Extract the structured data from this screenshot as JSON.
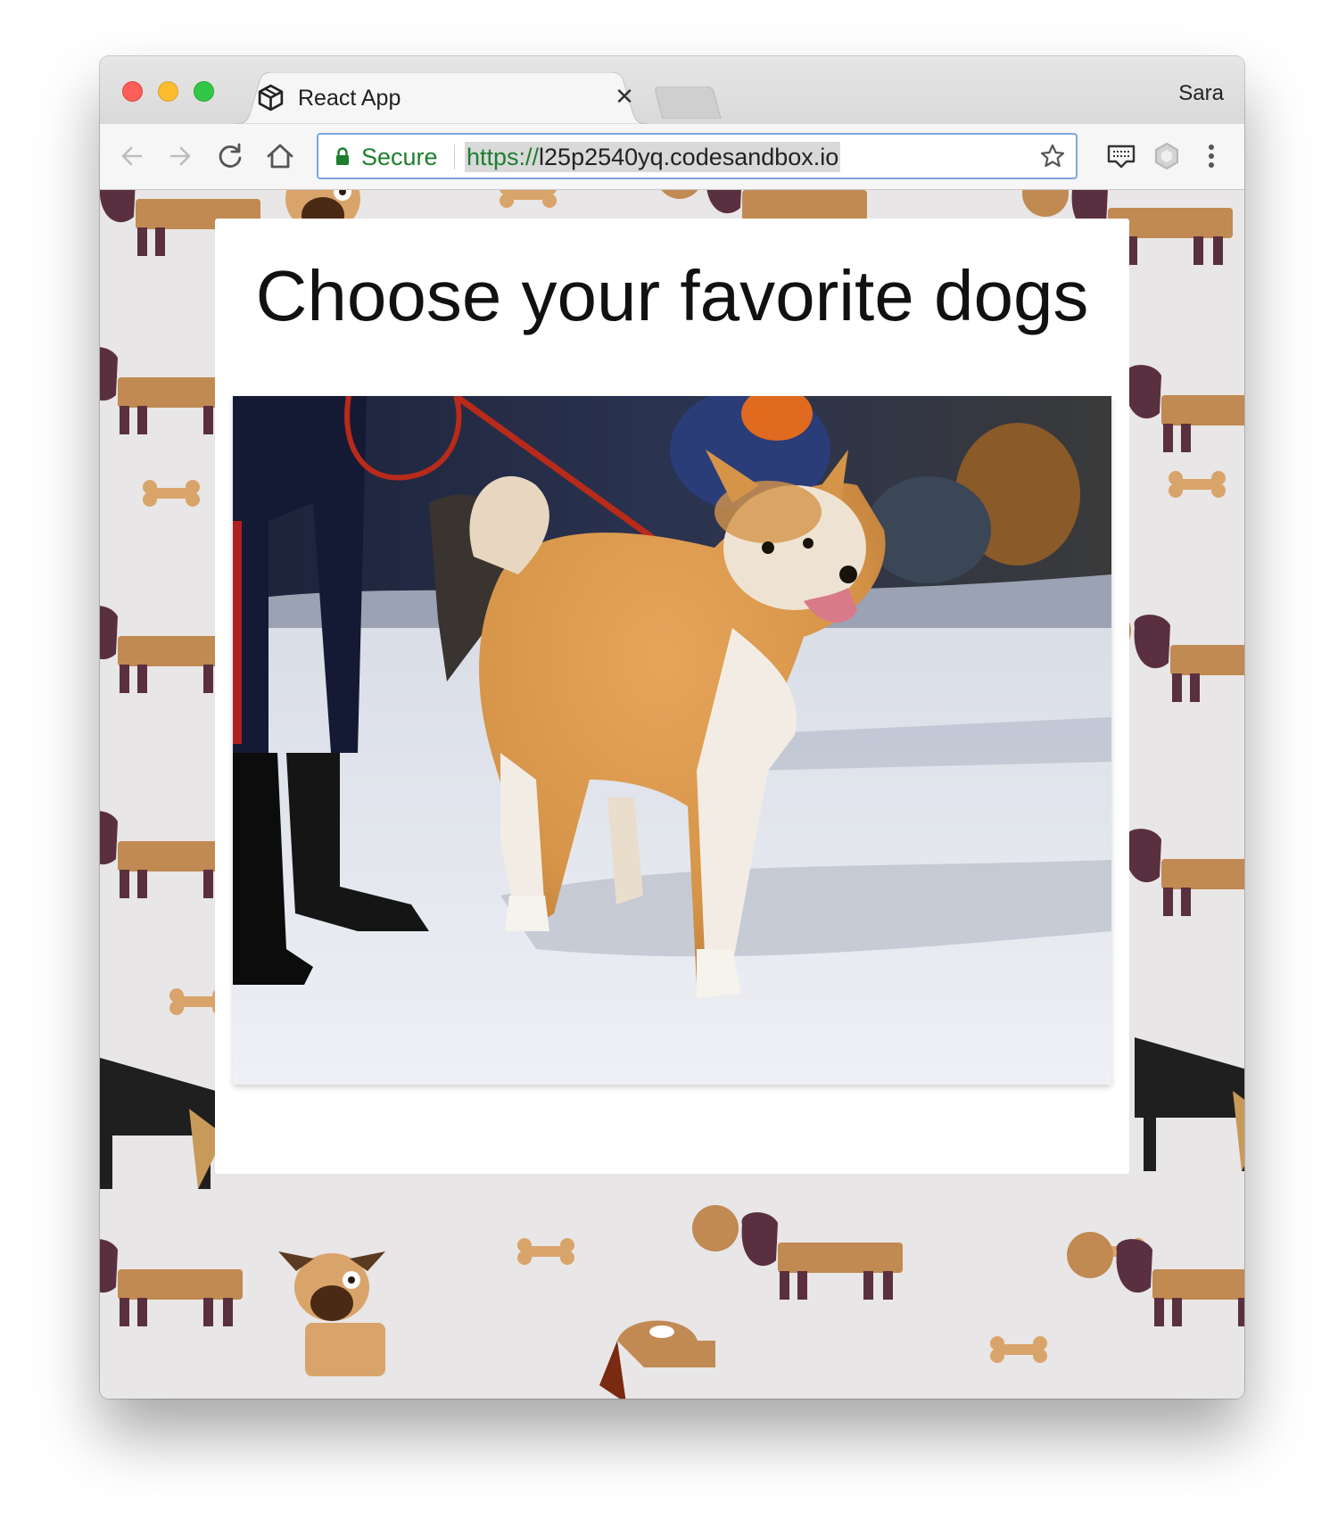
{
  "browser": {
    "tab": {
      "title": "React App",
      "icon": "codesandbox-cube-icon",
      "close_glyph": "✕"
    },
    "profile_name": "Sara",
    "toolbar": {
      "back_icon": "arrow-left-icon",
      "forward_icon": "arrow-right-icon",
      "reload_icon": "reload-icon",
      "home_icon": "home-icon"
    },
    "omnibox": {
      "security_label": "Secure",
      "url_scheme": "https://",
      "url_host": "l25p2540yq.codesandbox.io"
    },
    "extensions": [
      "screen-reader-icon",
      "extension-hexagon-icon"
    ],
    "menu_icon": "kebab-menu-icon"
  },
  "page": {
    "heading": "Choose your favorite dogs",
    "photo": {
      "subject": "akita-dog-on-snow"
    }
  },
  "colors": {
    "secure_green": "#1e7f2e",
    "omnibox_border": "#7ea6dc",
    "wallpaper_bg": "#e8e6e6",
    "dog_tan": "#c08a52",
    "dog_ear_plum": "#5a3040"
  }
}
